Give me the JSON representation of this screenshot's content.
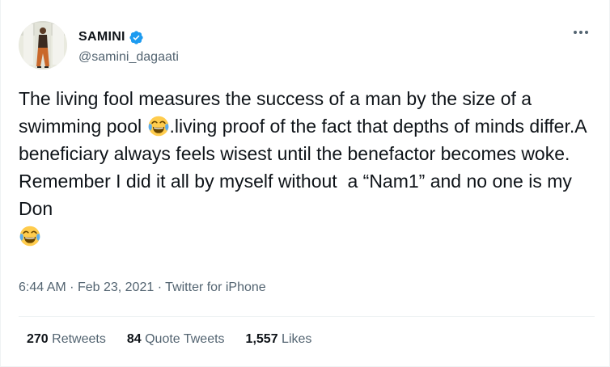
{
  "author": {
    "display_name": "SAMINI",
    "handle": "@samini_dagaati",
    "verified": true
  },
  "tweet": {
    "segments": [
      "The living fool measures the success of a man by the size of a swimming pool ",
      ".living proof of the fact that depths of minds differ.A beneficiary always feels wisest until the benefactor becomes woke. Remember I did it all by myself without  a “Nam1” and no one is my Don",
      ""
    ],
    "emoji": "face-with-tears-of-joy"
  },
  "meta": {
    "time": "6:44 AM",
    "date": "Feb 23, 2021",
    "source": "Twitter for iPhone",
    "separator": "·"
  },
  "stats": {
    "retweets_count": "270",
    "retweets_label": "Retweets",
    "quote_count": "84",
    "quote_label": "Quote Tweets",
    "likes_count": "1,557",
    "likes_label": "Likes"
  },
  "icons": {
    "verified": "verified-badge-icon",
    "more": "more-options-icon"
  },
  "colors": {
    "text": "#0f1419",
    "secondary": "#536471",
    "verified": "#1d9bf0",
    "divider": "#eff3f4"
  }
}
